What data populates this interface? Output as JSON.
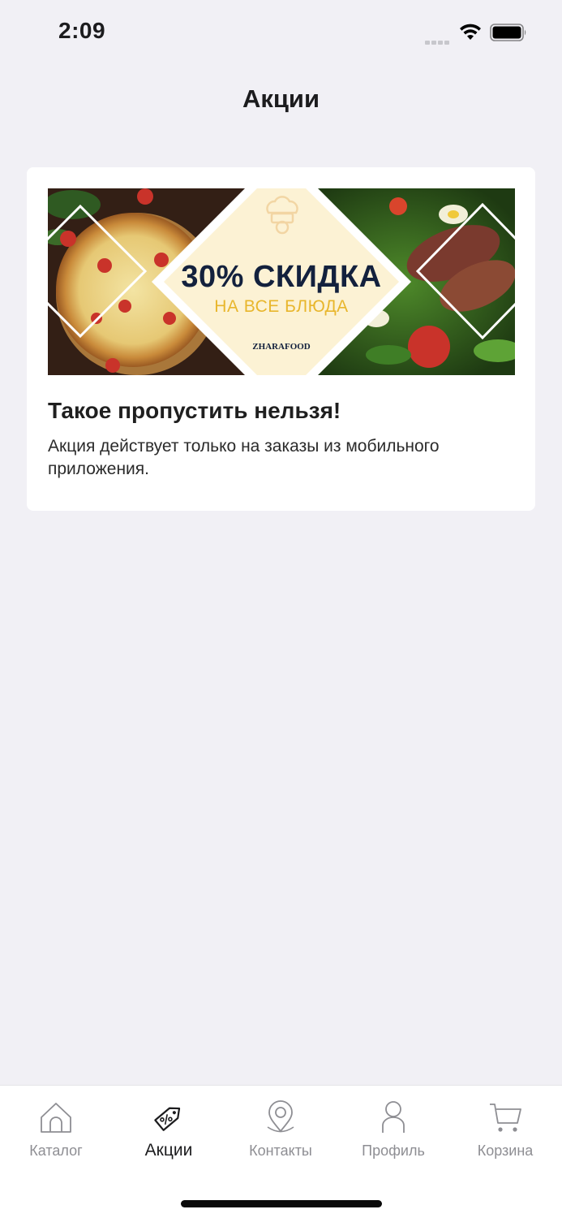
{
  "status_bar": {
    "time": "2:09"
  },
  "header": {
    "title": "Акции"
  },
  "promo": {
    "banner": {
      "headline": "30% СКИДКА",
      "subline": "НА ВСЕ БЛЮДА",
      "brand": "ZHARAFOOD"
    },
    "title": "Такое пропустить нельзя!",
    "description": "Акция действует только на заказы из мобильного приложения."
  },
  "tab_bar": {
    "items": [
      {
        "label": "Каталог",
        "icon": "home-icon",
        "active": false
      },
      {
        "label": "Акции",
        "icon": "price-tag-icon",
        "active": true
      },
      {
        "label": "Контакты",
        "icon": "location-pin-icon",
        "active": false
      },
      {
        "label": "Профиль",
        "icon": "user-icon",
        "active": false
      },
      {
        "label": "Корзина",
        "icon": "cart-icon",
        "active": false
      }
    ]
  },
  "colors": {
    "background": "#f1f0f5",
    "card": "#ffffff",
    "accent_gold": "#e8b62c",
    "headline_navy": "#13213d",
    "inactive_tab": "#8e8e93"
  }
}
